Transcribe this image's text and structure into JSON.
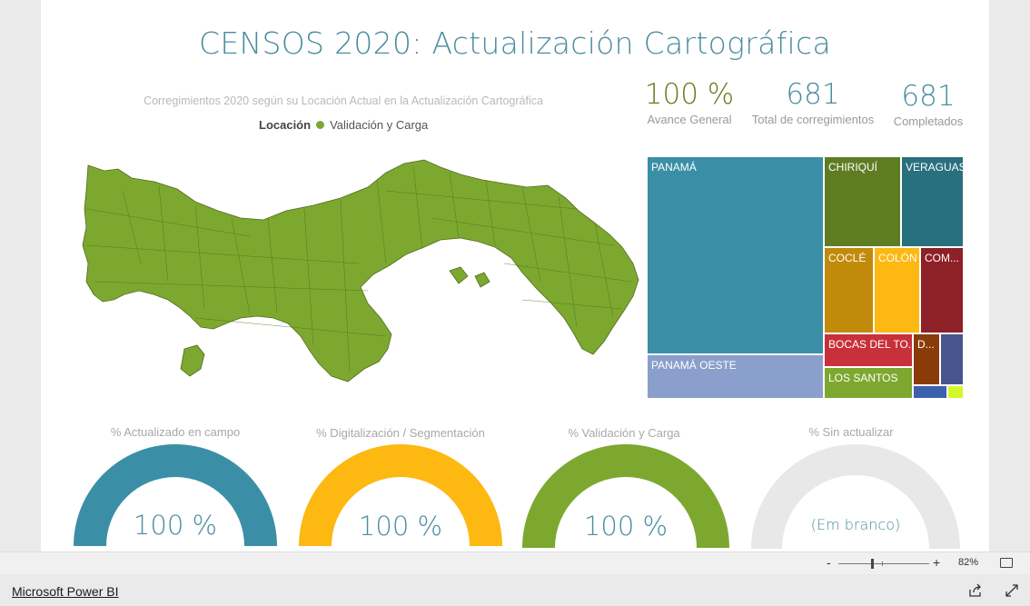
{
  "report": {
    "title": "CENSOS 2020: Actualización Cartográfica",
    "map_title": "Corregimientos 2020 según su Locación Actual en la Actualización Cartográfica",
    "legend_label": "Locación",
    "legend_item": "Validación y Carga",
    "legend_color": "#7da82f"
  },
  "kpis": [
    {
      "value": "100 %",
      "caption": "Avance General",
      "color": "#6b7a1a"
    },
    {
      "value": "681",
      "caption": "Total de corregimientos",
      "color": "#4a8da0"
    },
    {
      "value": "681",
      "caption": "Completados",
      "color": "#4a8da0"
    }
  ],
  "treemap": [
    {
      "label": "PANAMÁ",
      "color": "#3a8fa6"
    },
    {
      "label": "PANAMÁ OESTE",
      "color": "#8a9fcb"
    },
    {
      "label": "CHIRIQUÍ",
      "color": "#5e7d23"
    },
    {
      "label": "VERAGUAS",
      "color": "#29707e"
    },
    {
      "label": "COCLÉ",
      "color": "#c28a0a"
    },
    {
      "label": "COLÓN",
      "color": "#fdb812"
    },
    {
      "label": "COM...",
      "color": "#8e2027"
    },
    {
      "label": "BOCAS DEL TO...",
      "color": "#c8303a"
    },
    {
      "label": "D...",
      "color": "#8a3c08"
    },
    {
      "label": "",
      "color": "#46558d"
    },
    {
      "label": "LOS SANTOS",
      "color": "#7da82f"
    },
    {
      "label": "",
      "color": "#3c5fae"
    },
    {
      "label": "",
      "color": "#d4f72a"
    }
  ],
  "gauges": [
    {
      "title": "% Actualizado en campo",
      "value": "100 %",
      "fraction": 1,
      "color": "#3a8fa6"
    },
    {
      "title": "% Digitalización / Segmentación",
      "value": "100 %",
      "fraction": 1,
      "color": "#fdb812"
    },
    {
      "title": "% Validación y Carga",
      "value": "100 %",
      "fraction": 1,
      "color": "#7da82f"
    },
    {
      "title": "% Sin actualizar",
      "value": "(Em branco)",
      "fraction": 0,
      "color": "#e8e8e8"
    }
  ],
  "zoom": {
    "minus": "-",
    "plus": "+",
    "percent": "82%"
  },
  "footer": {
    "brand": "Microsoft Power BI"
  }
}
